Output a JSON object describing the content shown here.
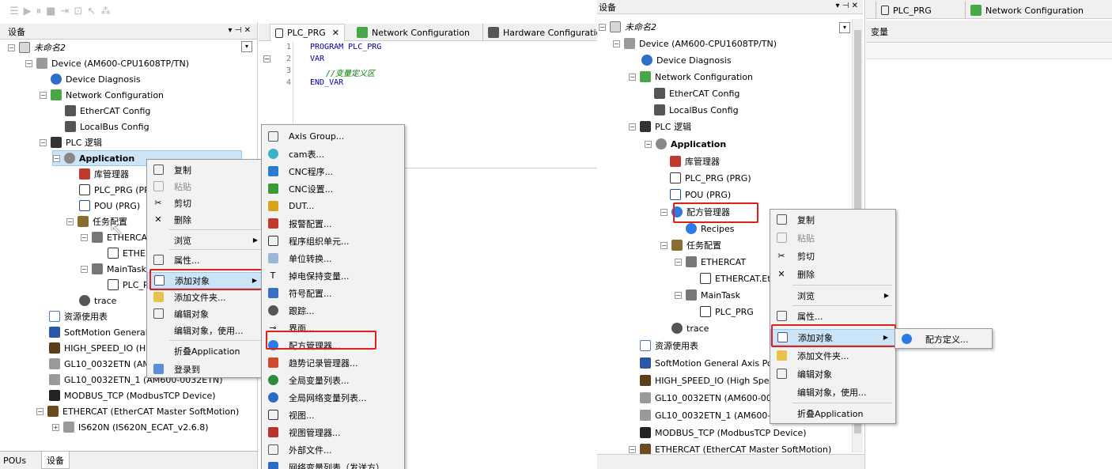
{
  "left": {
    "panel_title": "设备",
    "tree": [
      {
        "label": "未命名2",
        "italic": true,
        "icon": "project-icon"
      },
      {
        "label": "Device (AM600-CPU1608TP/TN)",
        "icon": "device-icon"
      },
      {
        "label": "Device Diagnosis",
        "icon": "diagnosis-icon"
      },
      {
        "label": "Network Configuration",
        "icon": "network-icon"
      },
      {
        "label": "EtherCAT Config",
        "icon": "config-icon"
      },
      {
        "label": "LocalBus Config",
        "icon": "config-icon"
      },
      {
        "label": "PLC 逻辑",
        "icon": "plc-icon"
      },
      {
        "label": "Application",
        "bold": true,
        "icon": "application-icon"
      },
      {
        "label": "库管理器",
        "icon": "library-icon"
      },
      {
        "label": "PLC_PRG (PRG)",
        "icon": "prg-icon"
      },
      {
        "label": "POU (PRG)",
        "icon": "pou-icon"
      },
      {
        "label": "任务配置",
        "icon": "task-icon"
      },
      {
        "label": "ETHERCAT",
        "icon": "task-item-icon"
      },
      {
        "label": "ETHERCAT.EtherCAT_Task",
        "icon": "call-icon"
      },
      {
        "label": "MainTask",
        "icon": "task-item-icon"
      },
      {
        "label": "PLC_PRG",
        "icon": "call-icon"
      },
      {
        "label": "trace",
        "icon": "trace-icon"
      },
      {
        "label": "资源使用表",
        "icon": "table-icon"
      },
      {
        "label": "SoftMotion General Axis Pool",
        "icon": "axis-icon"
      },
      {
        "label": "HIGH_SPEED_IO (High Speed IO)",
        "icon": "io-icon"
      },
      {
        "label": "GL10_0032ETN (AM600-0032ETN)",
        "icon": "module-icon"
      },
      {
        "label": "GL10_0032ETN_1 (AM600-0032ETN)",
        "icon": "module-icon"
      },
      {
        "label": "MODBUS_TCP (ModbusTCP Device)",
        "icon": "modbus-icon"
      },
      {
        "label": "ETHERCAT (EtherCAT Master SoftMotion)",
        "icon": "ethercat-master-icon"
      },
      {
        "label": "IS620N (IS620N_ECAT_v2.6.8)",
        "icon": "drive-icon"
      }
    ],
    "bottom_tabs": [
      "POUs",
      "设备"
    ],
    "editor_tabs": [
      "PLC_PRG",
      "Network Configuration",
      "Hardware Configuration"
    ],
    "code_lines": [
      {
        "num": "1",
        "text": "PROGRAM PLC_PRG",
        "kind": "kw"
      },
      {
        "num": "2",
        "text": "VAR",
        "kind": "kw"
      },
      {
        "num": "3",
        "text": "//变量定义区",
        "kind": "cm"
      },
      {
        "num": "4",
        "text": "END_VAR",
        "kind": "kw"
      }
    ],
    "context_menu": [
      "复制",
      "粘贴",
      "剪切",
      "删除",
      "浏览",
      "属性...",
      "添加对象",
      "添加文件夹...",
      "编辑对象",
      "编辑对象，使用...",
      "折叠Application",
      "登录到"
    ],
    "submenu": [
      "Axis Group...",
      "cam表...",
      "CNC程序...",
      "CNC设置...",
      "DUT...",
      "报警配置...",
      "程序组织单元...",
      "单位转换...",
      "掉电保持变量...",
      "符号配置...",
      "跟踪...",
      "界面...",
      "配方管理器...",
      "趋势记录管理器...",
      "全局变量列表...",
      "全局网络变量列表...",
      "视图...",
      "视图管理器...",
      "外部文件...",
      "网络变量列表（发送方）..."
    ]
  },
  "right": {
    "panel_title": "设备",
    "tree": [
      {
        "label": "未命名2",
        "italic": true
      },
      {
        "label": "Device (AM600-CPU1608TP/TN)"
      },
      {
        "label": "Device Diagnosis"
      },
      {
        "label": "Network Configuration"
      },
      {
        "label": "EtherCAT Config"
      },
      {
        "label": "LocalBus Config"
      },
      {
        "label": "PLC 逻辑"
      },
      {
        "label": "Application",
        "bold": true
      },
      {
        "label": "库管理器"
      },
      {
        "label": "PLC_PRG (PRG)"
      },
      {
        "label": "POU (PRG)"
      },
      {
        "label": "配方管理器"
      },
      {
        "label": "Recipes"
      },
      {
        "label": "任务配置"
      },
      {
        "label": "ETHERCAT"
      },
      {
        "label": "ETHERCAT.EtherCAT_Task"
      },
      {
        "label": "MainTask"
      },
      {
        "label": "PLC_PRG"
      },
      {
        "label": "trace"
      },
      {
        "label": "资源使用表"
      },
      {
        "label": "SoftMotion General Axis Pool"
      },
      {
        "label": "HIGH_SPEED_IO (High Speed IO)"
      },
      {
        "label": "GL10_0032ETN (AM600-0032ETN)"
      },
      {
        "label": "GL10_0032ETN_1 (AM600-0032ETN)"
      },
      {
        "label": "MODBUS_TCP (ModbusTCP Device)"
      },
      {
        "label": "ETHERCAT (EtherCAT Master SoftMotion)"
      }
    ],
    "editor_tabs": [
      "PLC_PRG",
      "Network Configuration"
    ],
    "variables_header": "变量",
    "context_menu": [
      "复制",
      "粘贴",
      "剪切",
      "删除",
      "浏览",
      "属性...",
      "添加对象",
      "添加文件夹...",
      "编辑对象",
      "编辑对象，使用...",
      "折叠Application"
    ],
    "submenu": [
      "配方定义..."
    ]
  },
  "colors": {
    "highlight_red": "#e0201b",
    "selection_blue": "#cce4f7",
    "menu_bg": "#f2f2f2"
  }
}
